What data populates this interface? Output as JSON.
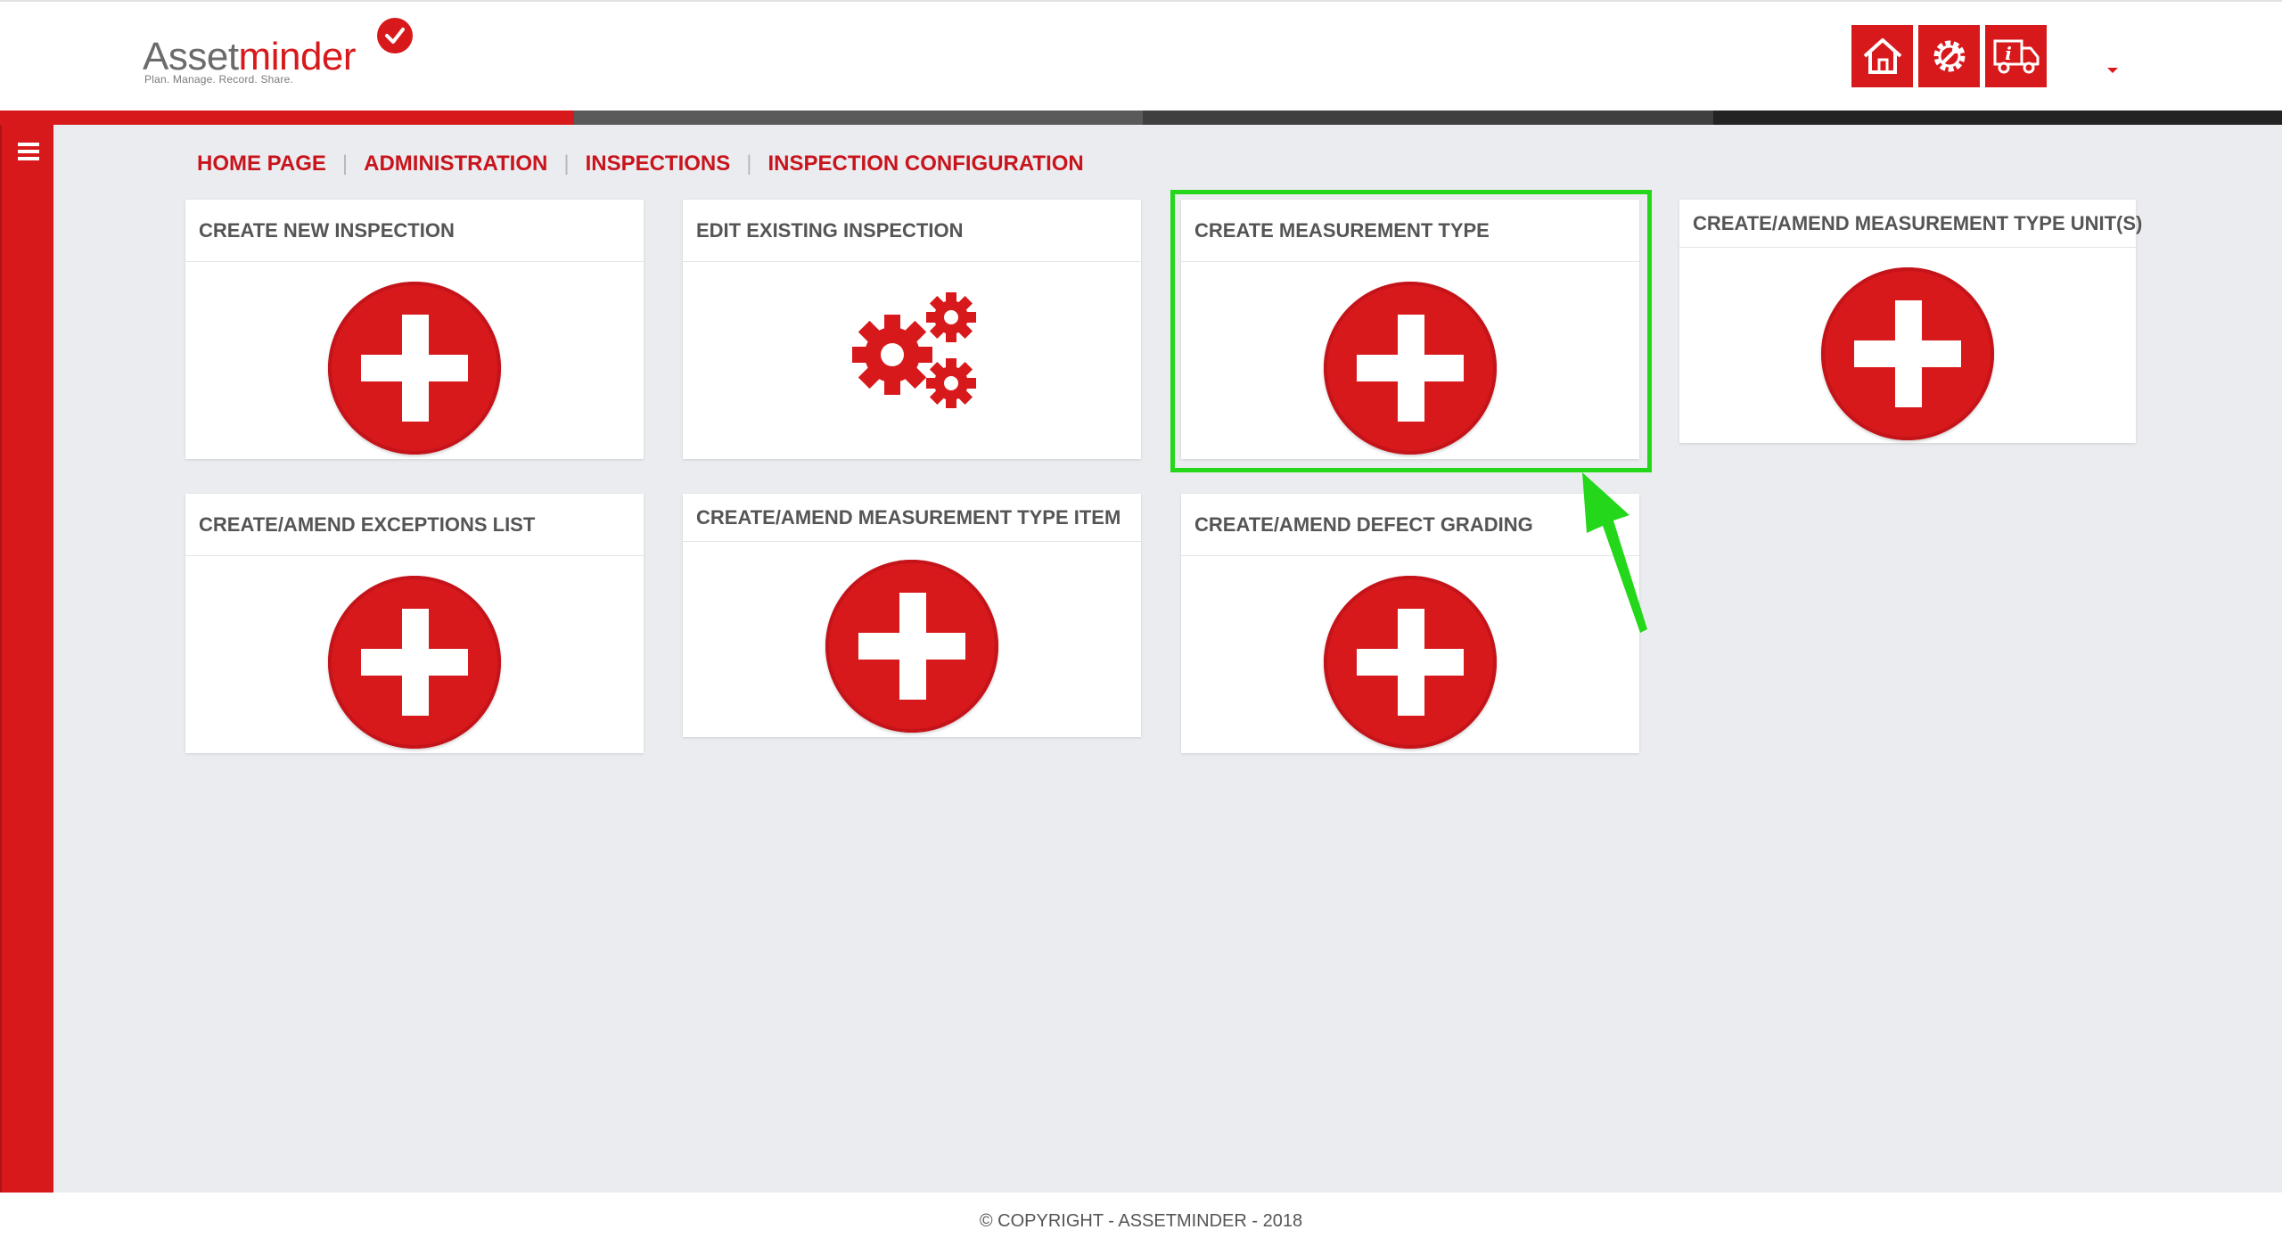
{
  "header": {
    "logo": {
      "word_a": "Asset",
      "word_b": "minder",
      "tagline": "Plan. Manage. Record. Share."
    },
    "icons": [
      "home-icon",
      "gear-wrench-icon",
      "truck-info-icon"
    ],
    "accent_color": "#d7191c"
  },
  "breadcrumb": {
    "items": [
      "HOME PAGE",
      "ADMINISTRATION",
      "INSPECTIONS",
      "INSPECTION CONFIGURATION"
    ],
    "separator": "|"
  },
  "tiles": [
    {
      "title": "CREATE NEW INSPECTION",
      "icon": "plus-circle-icon"
    },
    {
      "title": "EDIT EXISTING INSPECTION",
      "icon": "gears-icon"
    },
    {
      "title": "CREATE MEASUREMENT TYPE",
      "icon": "plus-circle-icon"
    },
    {
      "title": "CREATE/AMEND MEASUREMENT TYPE UNIT(S)",
      "icon": "plus-circle-icon"
    },
    {
      "title": "CREATE/AMEND EXCEPTIONS LIST",
      "icon": "plus-circle-icon"
    },
    {
      "title": "CREATE/AMEND MEASUREMENT TYPE ITEM",
      "icon": "plus-circle-icon"
    },
    {
      "title": "CREATE/AMEND DEFECT GRADING",
      "icon": "plus-circle-icon"
    }
  ],
  "annotation": {
    "highlight_color": "#25d71b",
    "highlighted_tile": "CREATE MEASUREMENT TYPE"
  },
  "footer": {
    "text": "© COPYRIGHT - ASSETMINDER - 2018"
  }
}
